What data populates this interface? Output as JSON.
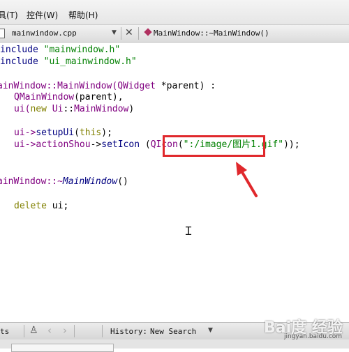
{
  "menubar": {
    "items": [
      "具(T)",
      "控件(W)",
      "帮助(H)"
    ]
  },
  "editor_toolbar": {
    "file_tab": "mainwindow.cpp",
    "dropdown_icon": "triangle-down",
    "split_icon": "split-icon",
    "close_icon": "close-icon",
    "function_selector": "MainWindow::~MainWindow()"
  },
  "code": {
    "l1_kw": "include",
    "l1_str": "\"mainwindow.h\"",
    "l2_kw": "include",
    "l2_str": "\"ui_mainwindow.h\"",
    "l3_a": "ainWindow::MainWindow(",
    "l3_b": "QWidget",
    "l3_c": " *parent) :",
    "l4_a": "QMainWindow",
    "l4_b": "(parent),",
    "l5_a": "ui(",
    "l5_b": "new",
    "l5_c": " ",
    "l5_d": "Ui",
    "l5_e": "::",
    "l5_f": "MainWindow",
    "l5_g": ")",
    "l6_a": "ui->",
    "l6_b": "setupUi",
    "l6_c": "(",
    "l6_d": "this",
    "l6_e": ");",
    "l7_a": "ui->",
    "l7_b": "actionShou",
    "l7_c": "->",
    "l7_d": "setIcon",
    "l7_e": " (",
    "l7_f": "QIcon",
    "l7_g": "(",
    "l7_h": "\":/image/图片1.gif\"",
    "l7_i": "));",
    "l8_a": "ainWindow::~",
    "l8_b": "MainWindow",
    "l8_c": "()",
    "l9_a": "delete",
    "l9_b": " ui;"
  },
  "bottombar": {
    "left_label": "ts",
    "history_label": "History:",
    "history_value": "New Search"
  },
  "watermark": {
    "brand": "Bai度 经验",
    "url": "jingyan.baidu.com"
  },
  "colors": {
    "string": "#008000",
    "class": "#800080",
    "function": "#000080",
    "keyword": "#808000",
    "highlight": "#e0282c"
  }
}
